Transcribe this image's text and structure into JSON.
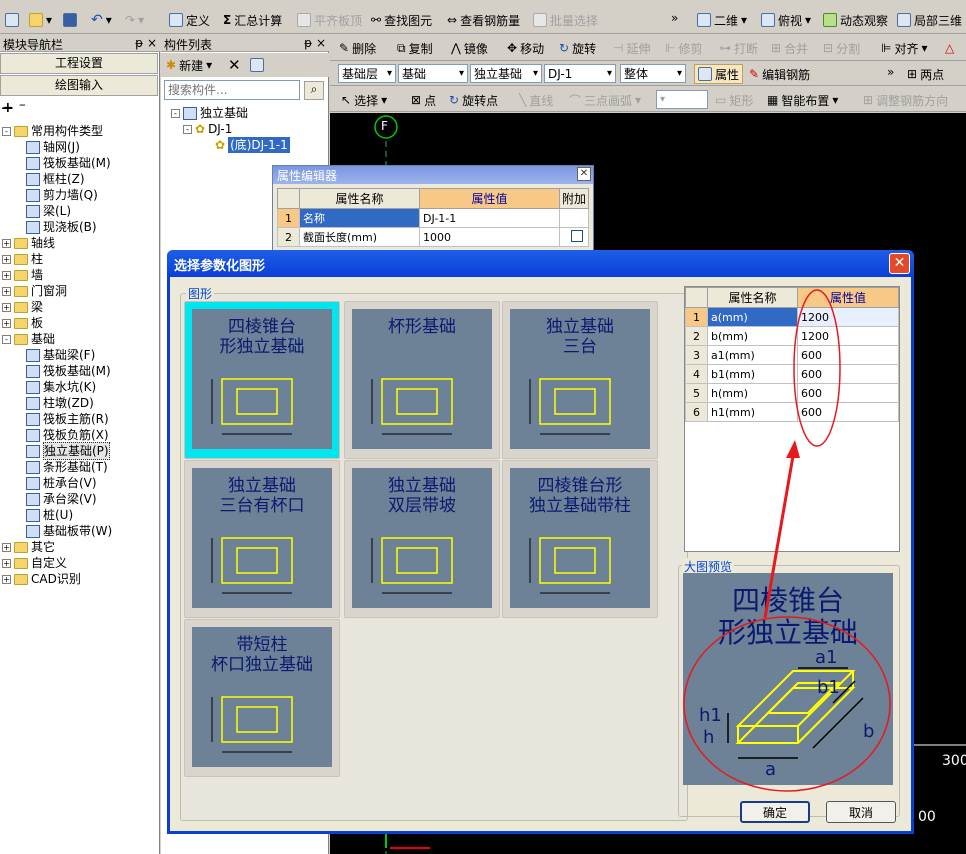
{
  "toolbar1": {
    "define": "定义",
    "sum": "汇总计算",
    "align_slab": "平齐板顶",
    "find_elem": "查找图元",
    "view_rebar": "查看钢筋量",
    "batch_select": "批量选择",
    "view_2d": "二维",
    "top_view": "俯视",
    "dyn_obs": "动态观察",
    "local_3d": "局部三维"
  },
  "left_panel": {
    "title": "模块导航栏",
    "pin": "ᵽ",
    "close": "×",
    "btn_project": "工程设置",
    "btn_draw": "绘图输入",
    "tree": [
      {
        "label": "常用构件类型",
        "level": 0,
        "exp": "-",
        "icon": "folder"
      },
      {
        "label": "轴网(J)",
        "level": 1,
        "icon": "s"
      },
      {
        "label": "筏板基础(M)",
        "level": 1,
        "icon": "s"
      },
      {
        "label": "框柱(Z)",
        "level": 1,
        "icon": "s"
      },
      {
        "label": "剪力墙(Q)",
        "level": 1,
        "icon": "s"
      },
      {
        "label": "梁(L)",
        "level": 1,
        "icon": "s"
      },
      {
        "label": "现浇板(B)",
        "level": 1,
        "icon": "s"
      },
      {
        "label": "轴线",
        "level": 0,
        "exp": "+",
        "icon": "folder"
      },
      {
        "label": "柱",
        "level": 0,
        "exp": "+",
        "icon": "folder"
      },
      {
        "label": "墙",
        "level": 0,
        "exp": "+",
        "icon": "folder"
      },
      {
        "label": "门窗洞",
        "level": 0,
        "exp": "+",
        "icon": "folder"
      },
      {
        "label": "梁",
        "level": 0,
        "exp": "+",
        "icon": "folder"
      },
      {
        "label": "板",
        "level": 0,
        "exp": "+",
        "icon": "folder"
      },
      {
        "label": "基础",
        "level": 0,
        "exp": "-",
        "icon": "folder"
      },
      {
        "label": "基础梁(F)",
        "level": 1,
        "icon": "s"
      },
      {
        "label": "筏板基础(M)",
        "level": 1,
        "icon": "s"
      },
      {
        "label": "集水坑(K)",
        "level": 1,
        "icon": "s"
      },
      {
        "label": "柱墩(ZD)",
        "level": 1,
        "icon": "s"
      },
      {
        "label": "筏板主筋(R)",
        "level": 1,
        "icon": "s"
      },
      {
        "label": "筏板负筋(X)",
        "level": 1,
        "icon": "s"
      },
      {
        "label": "独立基础(P)",
        "level": 1,
        "icon": "s",
        "selected": true
      },
      {
        "label": "条形基础(T)",
        "level": 1,
        "icon": "s"
      },
      {
        "label": "桩承台(V)",
        "level": 1,
        "icon": "s"
      },
      {
        "label": "承台梁(V)",
        "level": 1,
        "icon": "s"
      },
      {
        "label": "桩(U)",
        "level": 1,
        "icon": "s"
      },
      {
        "label": "基础板带(W)",
        "level": 1,
        "icon": "s"
      },
      {
        "label": "其它",
        "level": 0,
        "exp": "+",
        "icon": "folder"
      },
      {
        "label": "自定义",
        "level": 0,
        "exp": "+",
        "icon": "folder"
      },
      {
        "label": "CAD识别",
        "level": 0,
        "exp": "+",
        "icon": "folder"
      }
    ]
  },
  "comp_panel": {
    "title": "构件列表",
    "new_btn": "新建",
    "search_placeholder": "搜索构件...",
    "tree": [
      "独立基础",
      "DJ-1",
      "(底)DJ-1-1"
    ]
  },
  "toolbar2": {
    "delete": "删除",
    "copy": "复制",
    "mirror": "镜像",
    "move": "移动",
    "rotate": "旋转",
    "extend": "延伸",
    "trim": "修剪",
    "break": "打断",
    "merge": "合并",
    "split": "分割",
    "align": "对齐"
  },
  "toolbar3": {
    "layer": "基础层",
    "type": "基础",
    "sub": "独立基础",
    "item": "DJ-1",
    "whole": "整体",
    "prop": "属性",
    "edit_rebar": "编辑钢筋",
    "two_point": "两点"
  },
  "toolbar4": {
    "select": "选择",
    "point": "点",
    "rotate_point": "旋转点",
    "line": "直线",
    "arc": "三点画弧",
    "rect": "矩形",
    "smart": "智能布置",
    "adjust": "调整钢筋方向"
  },
  "canvas": {
    "axis_label": "F",
    "num1": "300",
    "num2": "00"
  },
  "prop_editor": {
    "title": "属性编辑器",
    "col_name": "属性名称",
    "col_value": "属性值",
    "col_add": "附加",
    "rows": [
      {
        "n": "1",
        "name": "名称",
        "value": "DJ-1-1"
      },
      {
        "n": "2",
        "name": "截面长度(mm)",
        "value": "1000"
      }
    ]
  },
  "dialog": {
    "title": "选择参数化图形",
    "group_shapes": "图形",
    "preview_label": "大图预览",
    "ok": "确定",
    "cancel": "取消",
    "shapes": [
      {
        "name": "四棱锥台形独立基础",
        "l1": "四棱锥台",
        "l2": "形独立基础"
      },
      {
        "name": "杯形基础",
        "l1": "杯形基础",
        "l2": ""
      },
      {
        "name": "独立基础三台",
        "l1": "独立基础",
        "l2": "三台"
      },
      {
        "name": "独立基础三台有杯口",
        "l1": "独立基础",
        "l2": "三台有杯口"
      },
      {
        "name": "独立基础双层带坡",
        "l1": "独立基础",
        "l2": "双层带坡"
      },
      {
        "name": "四棱锥台形独立基础带柱",
        "l1": "四棱锥台形",
        "l2": "独立基础带柱"
      },
      {
        "name": "带短柱杯口独立基础",
        "l1": "带短柱",
        "l2": "杯口独立基础"
      }
    ],
    "param_table": {
      "col_name": "属性名称",
      "col_value": "属性值",
      "rows": [
        {
          "n": "1",
          "name": "a(mm)",
          "value": "1200"
        },
        {
          "n": "2",
          "name": "b(mm)",
          "value": "1200"
        },
        {
          "n": "3",
          "name": "a1(mm)",
          "value": "600"
        },
        {
          "n": "4",
          "name": "b1(mm)",
          "value": "600"
        },
        {
          "n": "5",
          "name": "h(mm)",
          "value": "600"
        },
        {
          "n": "6",
          "name": "h1(mm)",
          "value": "600"
        }
      ]
    },
    "preview": {
      "l1": "四棱锥台",
      "l2": "形独立基础",
      "a": "a",
      "b": "b",
      "a1": "a1",
      "b1": "b1",
      "h": "h",
      "h1": "h1"
    }
  },
  "colors": {
    "annotation_red": "#e8191e",
    "dialog_blue": "#0a3fd6",
    "canvas_bg": "#000000",
    "thumb_bg": "#6d8297",
    "selected_cyan": "#00e5ee"
  }
}
